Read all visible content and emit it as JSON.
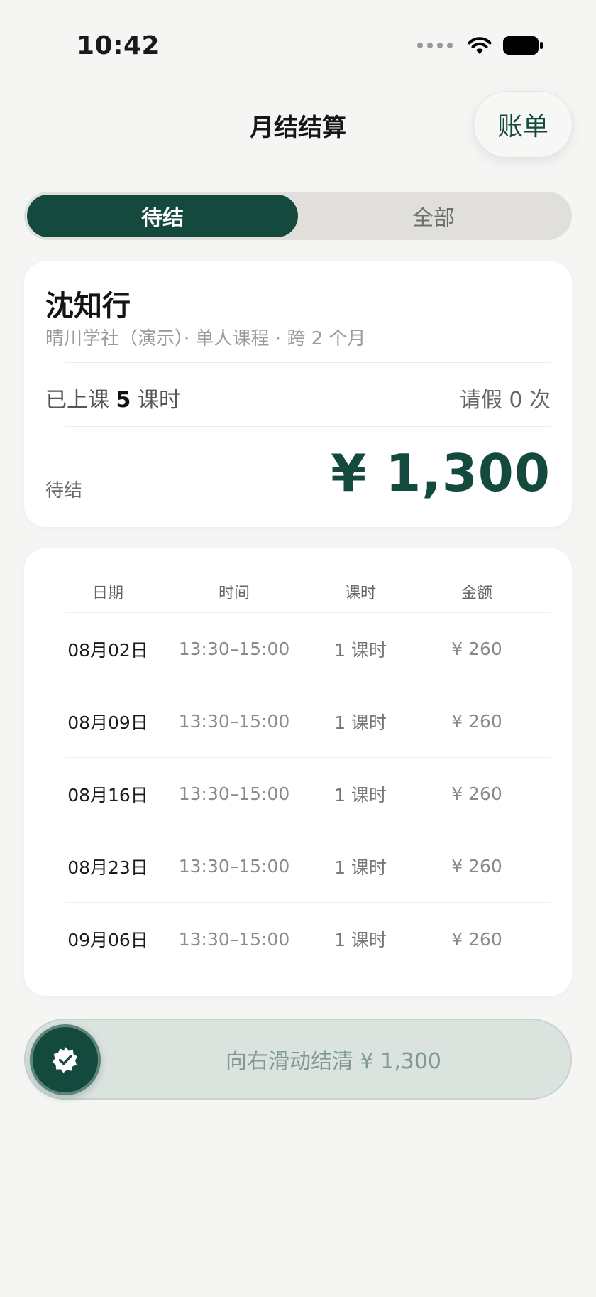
{
  "status_bar": {
    "time": "10:42"
  },
  "nav": {
    "title": "月结结算",
    "bill_button": "账单"
  },
  "tabs": [
    {
      "label": "待结",
      "active": true
    },
    {
      "label": "全部",
      "active": false
    }
  ],
  "summary": {
    "name": "沈知行",
    "meta": "晴川学社（演示）· 单人课程 · 跨 2 个月",
    "attended_prefix": "已上课",
    "attended_count": "5",
    "attended_unit": "课时",
    "leave": "请假 0 次",
    "status": "待结",
    "amount": "¥ 1,300"
  },
  "lessons": {
    "headers": {
      "date": "日期",
      "time": "时间",
      "hours": "课时",
      "amount": "金额"
    },
    "rows": [
      {
        "date": "08月02日",
        "time": "13:30–15:00",
        "hours": "1 课时",
        "amount": "¥ 260"
      },
      {
        "date": "08月09日",
        "time": "13:30–15:00",
        "hours": "1 课时",
        "amount": "¥ 260"
      },
      {
        "date": "08月16日",
        "time": "13:30–15:00",
        "hours": "1 课时",
        "amount": "¥ 260"
      },
      {
        "date": "08月23日",
        "time": "13:30–15:00",
        "hours": "1 课时",
        "amount": "¥ 260"
      },
      {
        "date": "09月06日",
        "time": "13:30–15:00",
        "hours": "1 课时",
        "amount": "¥ 260"
      }
    ]
  },
  "slider": {
    "label": "向右滑动结清 ¥ 1,300",
    "icon": "verified-check-icon"
  },
  "colors": {
    "primary": "#134a3d",
    "background": "#f5f5f4",
    "card": "#ffffff"
  }
}
